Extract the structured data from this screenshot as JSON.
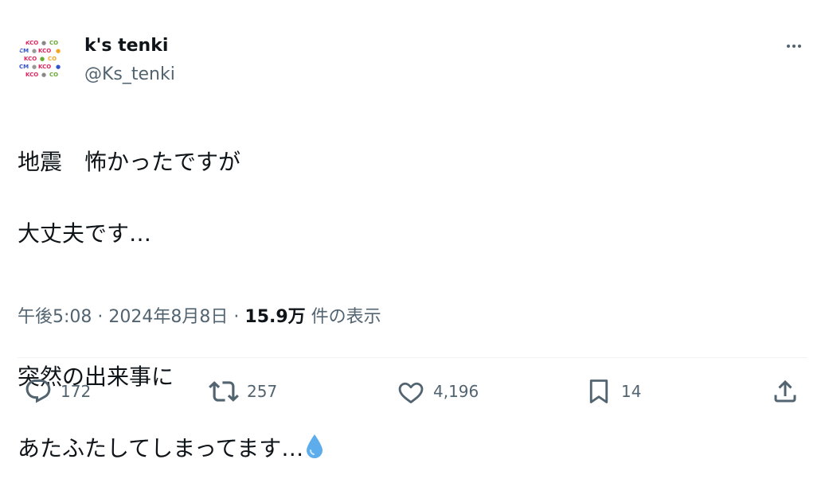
{
  "user": {
    "display_name": "k's tenki",
    "handle": "@Ks_tenki",
    "avatar_logo_text": "KCO"
  },
  "tweet": {
    "lines": [
      "地震　怖かったですが",
      "大丈夫です…",
      "",
      "突然の出来事に",
      "あたふたしてしまってます…"
    ],
    "trailing_emoji": "droplet-icon"
  },
  "meta": {
    "time": "午後5:08",
    "separator": "·",
    "date": "2024年8月8日",
    "views_count": "15.9万",
    "views_label": "件の表示"
  },
  "actions": {
    "reply_count": "172",
    "retweet_count": "257",
    "like_count": "4,196",
    "bookmark_count": "14"
  },
  "colors": {
    "text": "#0f1419",
    "muted": "#536471",
    "droplet": "#5dadec"
  }
}
